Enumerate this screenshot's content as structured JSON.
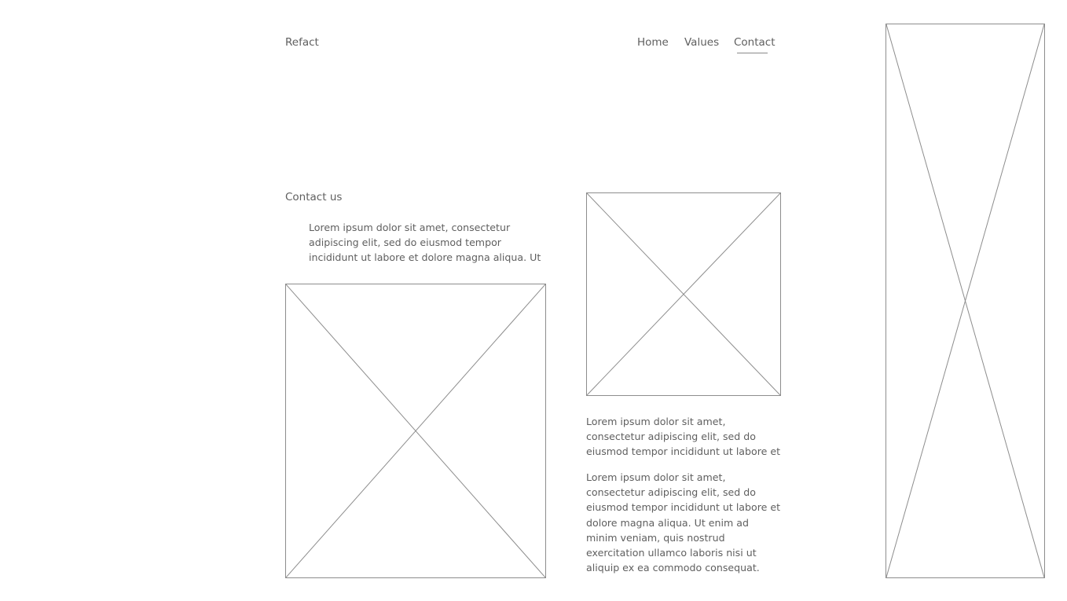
{
  "header": {
    "logo": "Refact",
    "nav": {
      "home": "Home",
      "values": "Values",
      "contact": "Contact"
    }
  },
  "main": {
    "heading": "Contact us",
    "intro": [
      "Lorem ipsum dolor sit amet, consectetur",
      "adipiscing elit, sed do eiusmod tempor",
      "incididunt ut labore et dolore magna aliqua. Ut"
    ],
    "text_a": [
      "Lorem ipsum dolor sit amet,",
      "consectetur adipiscing elit, sed do",
      "eiusmod tempor incididunt ut labore et"
    ],
    "text_b": [
      "Lorem ipsum dolor sit amet,",
      "consectetur adipiscing elit, sed do",
      "eiusmod tempor incididunt ut labore et",
      "dolore magna aliqua. Ut enim ad",
      "minim veniam, quis nostrud",
      "exercitation ullamco laboris nisi ut",
      "aliquip ex ea commodo consequat."
    ]
  },
  "colors": {
    "text": "#5f5f5f",
    "placeholder_stroke": "#8d8d8d",
    "background": "#ffffff"
  }
}
